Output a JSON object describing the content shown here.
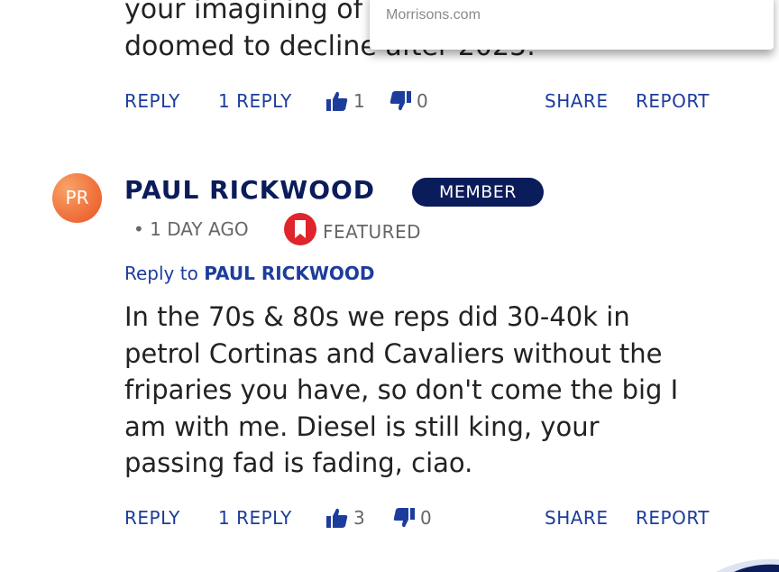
{
  "previous_comment": {
    "text_lines": [
      "your imagining of",
      "doomed to decline after 2025."
    ],
    "actions": {
      "reply": "REPLY",
      "replies": "1 REPLY",
      "upvotes": "1",
      "downvotes": "0",
      "share": "SHARE",
      "report": "REPORT"
    }
  },
  "popup": {
    "source": "Morrisons.com"
  },
  "comment": {
    "avatar_initials": "PR",
    "author": "PAUL RICKWOOD",
    "badge": "MEMBER",
    "time": "• 1 DAY AGO",
    "featured": "FEATURED",
    "reply_to_prefix": "Reply to",
    "reply_to_name": "PAUL RICKWOOD",
    "body_lines": [
      "In the 70s & 80s we reps did 30-40k in",
      "petrol Cortinas and Cavaliers without the",
      "friparies you have, so don't come the big I",
      "am with me. Diesel is still king, your",
      "passing fad is fading, ciao."
    ],
    "actions": {
      "reply": "REPLY",
      "replies": "1 REPLY",
      "upvotes": "3",
      "downvotes": "0",
      "share": "SHARE",
      "report": "REPORT"
    }
  },
  "colors": {
    "accent": "#1d3d9c",
    "navy": "#0b1c5a",
    "featured_red": "#e0242b",
    "avatar_orange": "#ee6a36"
  }
}
